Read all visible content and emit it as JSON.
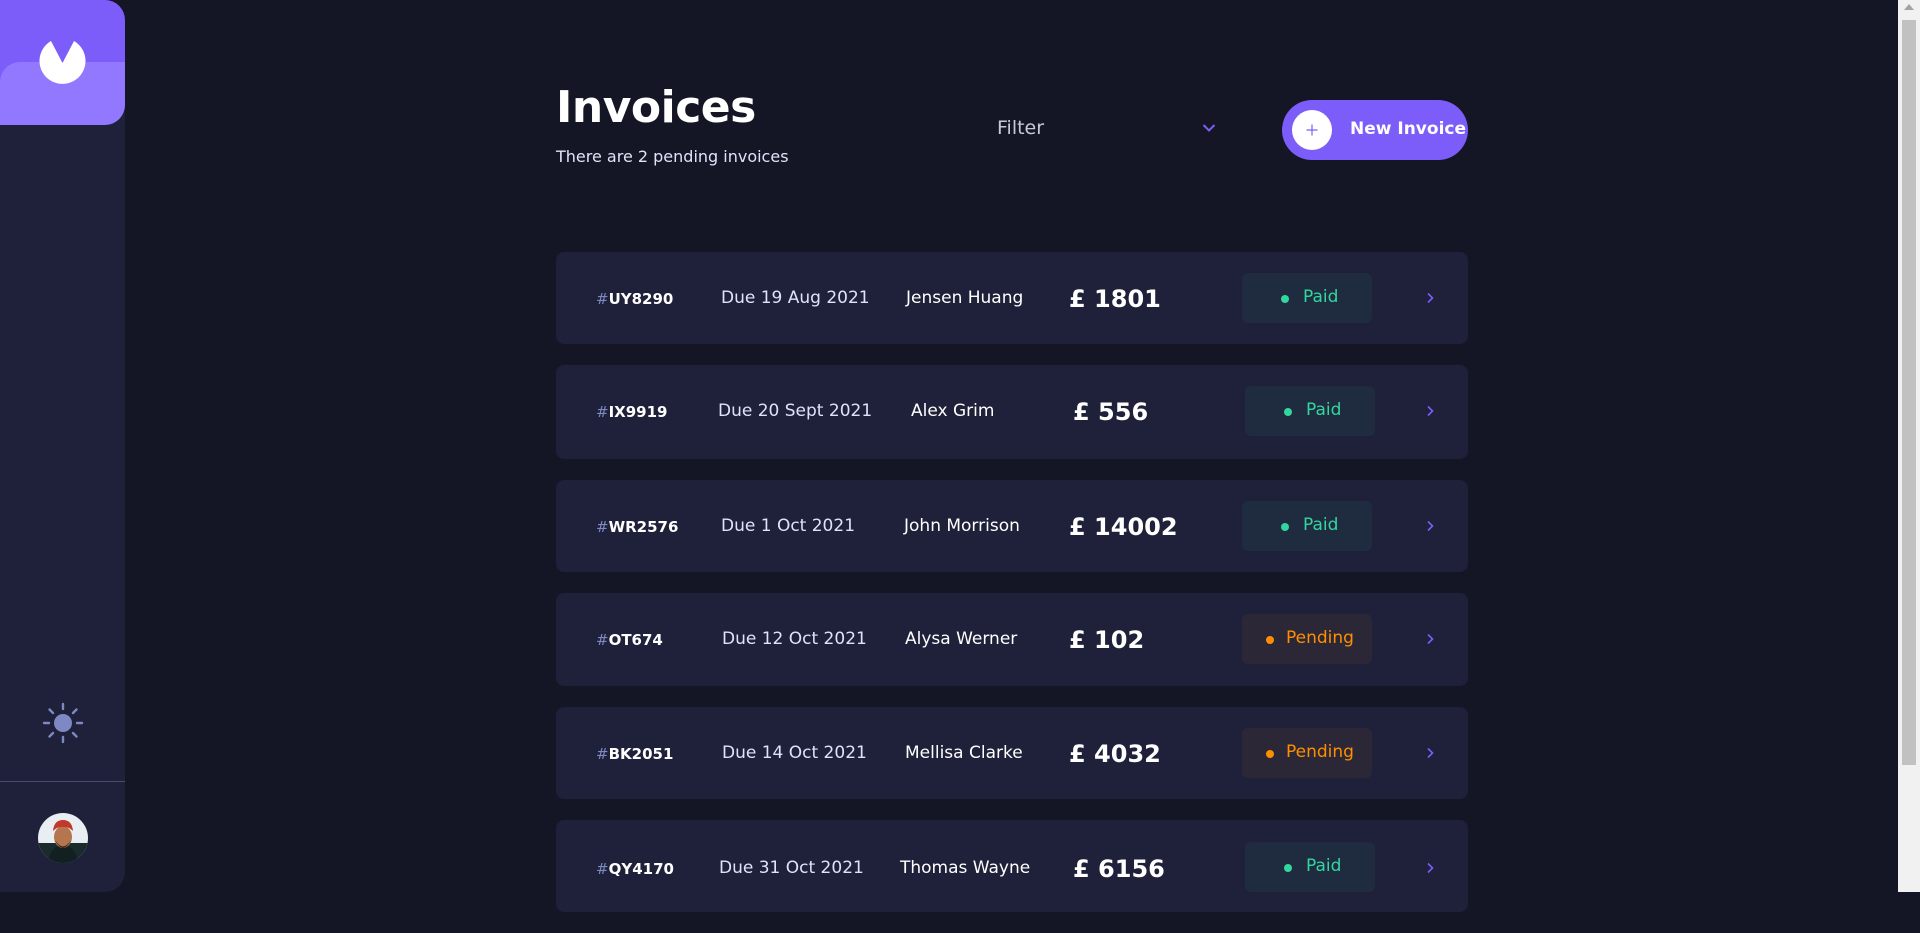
{
  "header": {
    "title": "Invoices",
    "subtitle": "There are 2 pending invoices",
    "filter_label": "Filter",
    "new_invoice_label": "New Invoice"
  },
  "sidebar": {
    "logo_icon": "logo-icon",
    "theme_icon": "sun-icon",
    "avatar": "user-avatar"
  },
  "colors": {
    "background": "#141625",
    "card": "#1e2139",
    "accent": "#7c5dfa",
    "paid": "#33d69f",
    "pending": "#ff8f00"
  },
  "invoices": [
    {
      "hash": "#",
      "id": "UY8290",
      "due": "Due 19 Aug 2021",
      "name": "Jensen Huang",
      "amount": "£ 1801",
      "status": "Paid"
    },
    {
      "hash": "#",
      "id": "IX9919",
      "due": "Due  20 Sept 2021",
      "name": "Alex Grim",
      "amount": "£ 556",
      "status": "Paid"
    },
    {
      "hash": "#",
      "id": "WR2576",
      "due": "Due 1 Oct 2021",
      "name": "John Morrison",
      "amount": "£ 14002",
      "status": "Paid"
    },
    {
      "hash": "#",
      "id": "OT674",
      "due": "Due 12 Oct 2021",
      "name": "Alysa Werner",
      "amount": "£ 102",
      "status": "Pending"
    },
    {
      "hash": "#",
      "id": "BK2051",
      "due": "Due 14 Oct 2021",
      "name": "Mellisa Clarke",
      "amount": "£ 4032",
      "status": "Pending"
    },
    {
      "hash": "#",
      "id": "QY4170",
      "due": "Due  31 Oct 2021",
      "name": "Thomas Wayne",
      "amount": "£ 6156",
      "status": "Paid"
    }
  ]
}
